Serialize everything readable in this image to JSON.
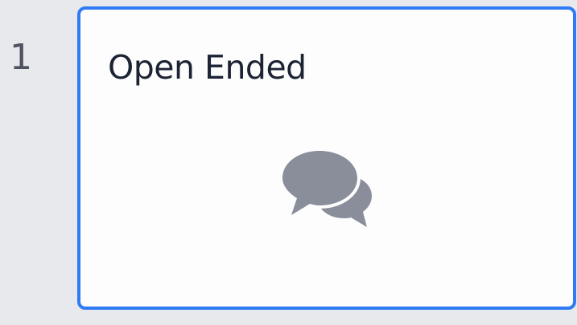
{
  "slide": {
    "number": "1",
    "title": "Open Ended",
    "icon": "chat-bubbles-icon",
    "selected": true
  },
  "colors": {
    "background": "#e8e9ec",
    "card_border": "#2f7bf5",
    "card_fill": "#fdfdfe",
    "title_text": "#1c2333",
    "icon": "#8a8e9b",
    "number_text": "#4e5360"
  }
}
